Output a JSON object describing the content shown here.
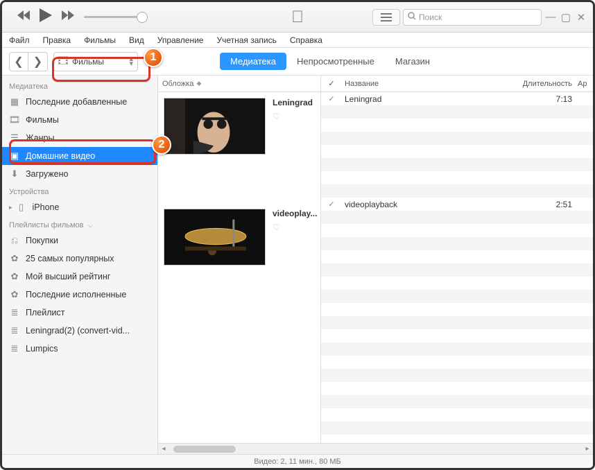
{
  "topbar": {
    "search_placeholder": "Поиск"
  },
  "menubar": {
    "file": "Файл",
    "edit": "Правка",
    "movies": "Фильмы",
    "view": "Вид",
    "controls": "Управление",
    "account": "Учетная запись",
    "help": "Справка"
  },
  "toolbar": {
    "media_dropdown_label": "Фильмы"
  },
  "tabs": {
    "library": "Медиатека",
    "unwatched": "Непросмотренные",
    "store": "Магазин"
  },
  "sidebar": {
    "library_head": "Медиатека",
    "items": [
      {
        "label": "Последние добавленные"
      },
      {
        "label": "Фильмы"
      },
      {
        "label": "Жанры"
      },
      {
        "label": "Домашние видео"
      },
      {
        "label": "Загружено"
      }
    ],
    "devices_head": "Устройства",
    "device_label": "iPhone",
    "playlists_head": "Плейлисты фильмов",
    "playlists": [
      {
        "label": "Покупки"
      },
      {
        "label": "25 самых популярных"
      },
      {
        "label": "Мой высший рейтинг"
      },
      {
        "label": "Последние исполненные"
      },
      {
        "label": "Плейлист"
      },
      {
        "label": "Leningrad(2)  (convert-vid..."
      },
      {
        "label": "Lumpics"
      }
    ]
  },
  "album_header": "Обложка",
  "albums": [
    {
      "title": "Leningrad"
    },
    {
      "title": "videoplay..."
    }
  ],
  "track_header": {
    "check": "✓",
    "name": "Название",
    "duration": "Длительность",
    "last": "Ар"
  },
  "tracks": [
    {
      "check": "✓",
      "name": "Leningrad",
      "duration": "7:13"
    },
    {
      "check": "✓",
      "name": "videoplayback",
      "duration": "2:51"
    }
  ],
  "status": "Видео: 2, 11 мин., 80 МБ",
  "callouts": {
    "one": "1",
    "two": "2"
  }
}
